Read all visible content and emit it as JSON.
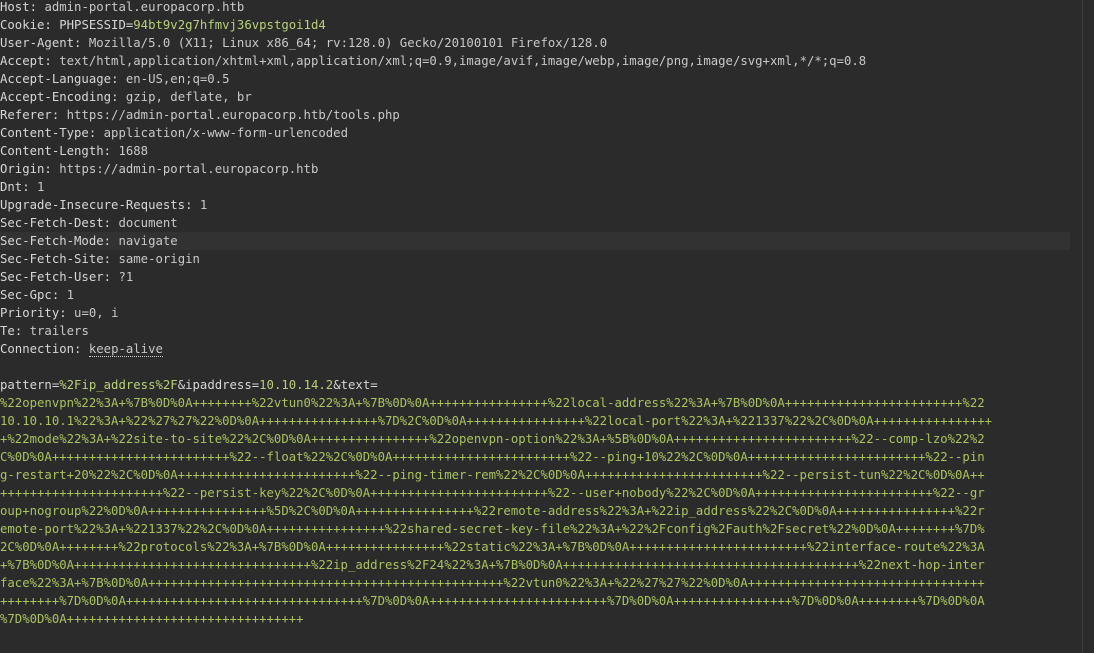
{
  "headers": [
    {
      "name": "Host",
      "value": "admin-portal.europacorp.htb"
    },
    {
      "name": "Cookie",
      "value": "PHPSESSID=94bt9v2g7hfmvj36vpstgoi1d4",
      "cookie_name": "PHPSESSID",
      "cookie_value": "94bt9v2g7hfmvj36vpstgoi1d4"
    },
    {
      "name": "User-Agent",
      "value": "Mozilla/5.0 (X11; Linux x86_64; rv:128.0) Gecko/20100101 Firefox/128.0"
    },
    {
      "name": "Accept",
      "value": "text/html,application/xhtml+xml,application/xml;q=0.9,image/avif,image/webp,image/png,image/svg+xml,*/*;q=0.8"
    },
    {
      "name": "Accept-Language",
      "value": "en-US,en;q=0.5"
    },
    {
      "name": "Accept-Encoding",
      "value": "gzip, deflate, br"
    },
    {
      "name": "Referer",
      "value": "https://admin-portal.europacorp.htb/tools.php"
    },
    {
      "name": "Content-Type",
      "value": "application/x-www-form-urlencoded"
    },
    {
      "name": "Content-Length",
      "value": "1688"
    },
    {
      "name": "Origin",
      "value": "https://admin-portal.europacorp.htb"
    },
    {
      "name": "Dnt",
      "value": "1"
    },
    {
      "name": "Upgrade-Insecure-Requests",
      "value": "1"
    },
    {
      "name": "Sec-Fetch-Dest",
      "value": "document"
    },
    {
      "name": "Sec-Fetch-Mode",
      "value": "navigate"
    },
    {
      "name": "Sec-Fetch-Site",
      "value": "same-origin"
    },
    {
      "name": "Sec-Fetch-User",
      "value": "?1"
    },
    {
      "name": "Sec-Gpc",
      "value": "1"
    },
    {
      "name": "Priority",
      "value": "u=0, i"
    },
    {
      "name": "Te",
      "value": "trailers"
    },
    {
      "name": "Connection",
      "value": "keep-alive"
    }
  ],
  "body": {
    "pattern_key": "pattern",
    "pattern_value": "%2Fip_address%2F",
    "ipaddress_key": "&ipaddress",
    "ipaddress_value": "10.10.14.2",
    "text_key": "&text",
    "lines": [
      "%22openvpn%22%3A+%7B%0D%0A++++++++%22vtun0%22%3A+%7B%0D%0A++++++++++++++++%22local-address%22%3A+%7B%0D%0A++++++++++++++++++++++++%22",
      "10.10.10.1%22%3A+%22%27%27%22%0D%0A++++++++++++++++%7D%2C%0D%0A++++++++++++++++%22local-port%22%3A+%221337%22%2C%0D%0A++++++++++++++++",
      "+%22mode%22%3A+%22site-to-site%22%2C%0D%0A++++++++++++++++%22openvpn-option%22%3A+%5B%0D%0A++++++++++++++++++++++++%22--comp-lzo%22%2",
      "C%0D%0A++++++++++++++++++++++++%22--float%22%2C%0D%0A++++++++++++++++++++++++%22--ping+10%22%2C%0D%0A++++++++++++++++++++++++%22--pin",
      "g-restart+20%22%2C%0D%0A++++++++++++++++++++++++%22--ping-timer-rem%22%2C%0D%0A++++++++++++++++++++++++%22--persist-tun%22%2C%0D%0A++",
      "++++++++++++++++++++++%22--persist-key%22%2C%0D%0A++++++++++++++++++++++++%22--user+nobody%22%2C%0D%0A++++++++++++++++++++++++%22--gr",
      "oup+nogroup%22%0D%0A++++++++++++++++%5D%2C%0D%0A++++++++++++++++%22remote-address%22%3A+%22ip_address%22%2C%0D%0A++++++++++++++++%22r",
      "emote-port%22%3A+%221337%22%2C%0D%0A++++++++++++++++%22shared-secret-key-file%22%3A+%22%2Fconfig%2Fauth%2Fsecret%22%0D%0A++++++++%7D%",
      "2C%0D%0A++++++++%22protocols%22%3A+%7B%0D%0A++++++++++++++++%22static%22%3A+%7B%0D%0A++++++++++++++++++++++++%22interface-route%22%3A",
      "+%7B%0D%0A++++++++++++++++++++++++++++++++%22ip_address%2F24%22%3A+%7B%0D%0A++++++++++++++++++++++++++++++++++++++++%22next-hop-inter",
      "face%22%3A+%7B%0D%0A++++++++++++++++++++++++++++++++++++++++++++++++%22vtun0%22%3A+%22%27%27%22%0D%0A++++++++++++++++++++++++++++++++",
      "++++++++%7D%0D%0A++++++++++++++++++++++++++++++++%7D%0D%0A++++++++++++++++++++++++%7D%0D%0A++++++++++++++++%7D%0D%0A++++++++%7D%0D%0A",
      "%7D%0D%0A++++++++++++++++++++++++++++++++"
    ]
  }
}
